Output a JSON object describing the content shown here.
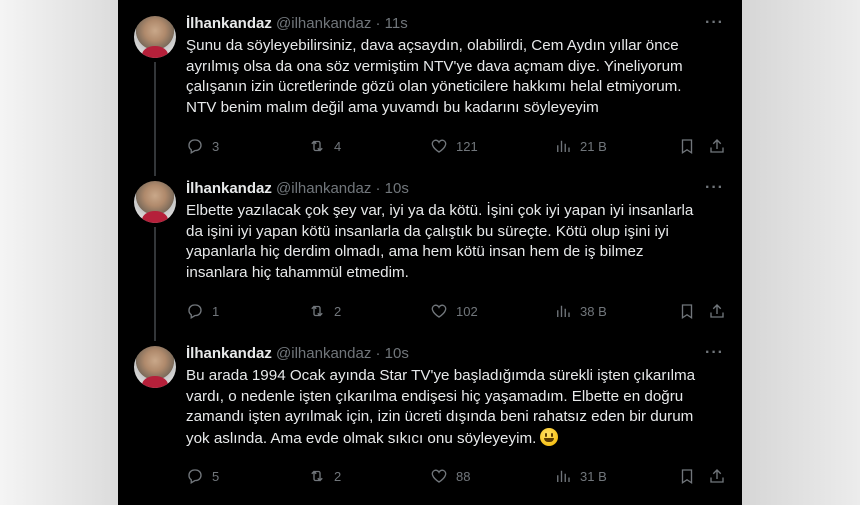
{
  "tweets": [
    {
      "name": "İlhankandaz",
      "handle": "@ilhankandaz",
      "dot": "·",
      "time": "11s",
      "more": "···",
      "lines": [
        "Şunu da söyleyebilirsiniz, dava açsaydın, olabilirdi,  Cem Aydın yıllar önce",
        "ayrılmış olsa da ona söz vermiştim NTV'ye dava açmam diye. Yineliyorum",
        "çalışanın izin ücretlerinde gözü olan yöneticilere hakkımı helal etmiyorum.",
        "NTV benim malım değil ama yuvamdı bu kadarını söyleyeyim"
      ],
      "replies": "3",
      "reposts": "4",
      "likes": "121",
      "views": "21 B"
    },
    {
      "name": "İlhankandaz",
      "handle": "@ilhankandaz",
      "dot": "·",
      "time": "10s",
      "more": "···",
      "lines": [
        "Elbette yazılacak çok şey var, iyi ya da kötü. İşini çok iyi yapan iyi insanlarla",
        "da işini iyi yapan kötü insanlarla da çalıştık bu süreçte. Kötü olup işini iyi",
        "yapanlarla hiç derdim olmadı, ama hem kötü insan hem de iş bilmez",
        "insanlara hiç tahammül etmedim."
      ],
      "replies": "1",
      "reposts": "2",
      "likes": "102",
      "views": "38 B"
    },
    {
      "name": "İlhankandaz",
      "handle": "@ilhankandaz",
      "dot": "·",
      "time": "10s",
      "more": "···",
      "lines": [
        "Bu arada 1994 Ocak ayında Star TV'ye başladığımda sürekli işten çıkarılma",
        "vardı, o nedenle işten çıkarılma endişesi hiç yaşamadım. Elbette en doğru",
        "zamandı işten ayrılmak için, izin ücreti dışında beni rahatsız eden bir durum",
        "yok aslında. Ama evde olmak sıkıcı onu söyleyeyim."
      ],
      "replies": "5",
      "reposts": "2",
      "likes": "88",
      "views": "31 B"
    }
  ],
  "icons": {
    "reply": "reply-icon",
    "repost": "repost-icon",
    "like": "like-icon",
    "views": "views-icon",
    "bookmark": "bookmark-icon",
    "share": "share-icon",
    "emoji": "grinning-face-emoji"
  },
  "colors": {
    "background": "#000000",
    "text": "#e7e9ea",
    "muted": "#71767b",
    "thread_line": "#333639"
  }
}
